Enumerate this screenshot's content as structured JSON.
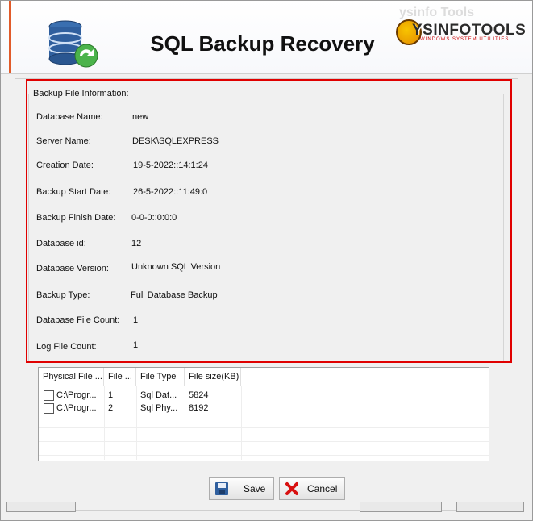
{
  "app": {
    "title": "SQL Backup Recovery"
  },
  "logo": {
    "text": "YSINFOTOOLS",
    "subtitle": "WINDOWS SYSTEM UTILITIES",
    "ghost_text": "ysinfo Tools"
  },
  "group": {
    "title": "Backup File Information:"
  },
  "info": [
    {
      "label": "Database Name:",
      "value": "new"
    },
    {
      "label": "Server Name:",
      "value": "DESK\\SQLEXPRESS"
    },
    {
      "label": "Creation Date:",
      "value": "19-5-2022::14:1:24"
    },
    {
      "label": "Backup Start Date:",
      "value": "26-5-2022::11:49:0"
    },
    {
      "label": "Backup Finish Date:",
      "value": "0-0-0::0:0:0"
    },
    {
      "label": "Database id:",
      "value": "12"
    },
    {
      "label": "Database Version:",
      "value": "Unknown SQL Version"
    },
    {
      "label": "Backup Type:",
      "value": "Full Database Backup"
    },
    {
      "label": "Database File Count:",
      "value": "1"
    },
    {
      "label": "Log File Count:",
      "value": "1"
    }
  ],
  "table": {
    "columns": [
      "Physical File ...",
      "File ...",
      "File Type",
      "File size(KB)"
    ],
    "rows": [
      {
        "checked": false,
        "physical": "C:\\Progr...",
        "file": "1",
        "type": "Sql Dat...",
        "size": "5824"
      },
      {
        "checked": false,
        "physical": "C:\\Progr...",
        "file": "2",
        "type": "Sql Phy...",
        "size": "8192"
      }
    ]
  },
  "buttons": {
    "save": "Save",
    "cancel": "Cancel"
  },
  "icons": {
    "save": "floppy-disk-icon",
    "cancel": "red-x-icon",
    "app": "database-refresh-icon"
  },
  "colors": {
    "highlight": "#e00000",
    "brand_orange": "#f8c400"
  }
}
